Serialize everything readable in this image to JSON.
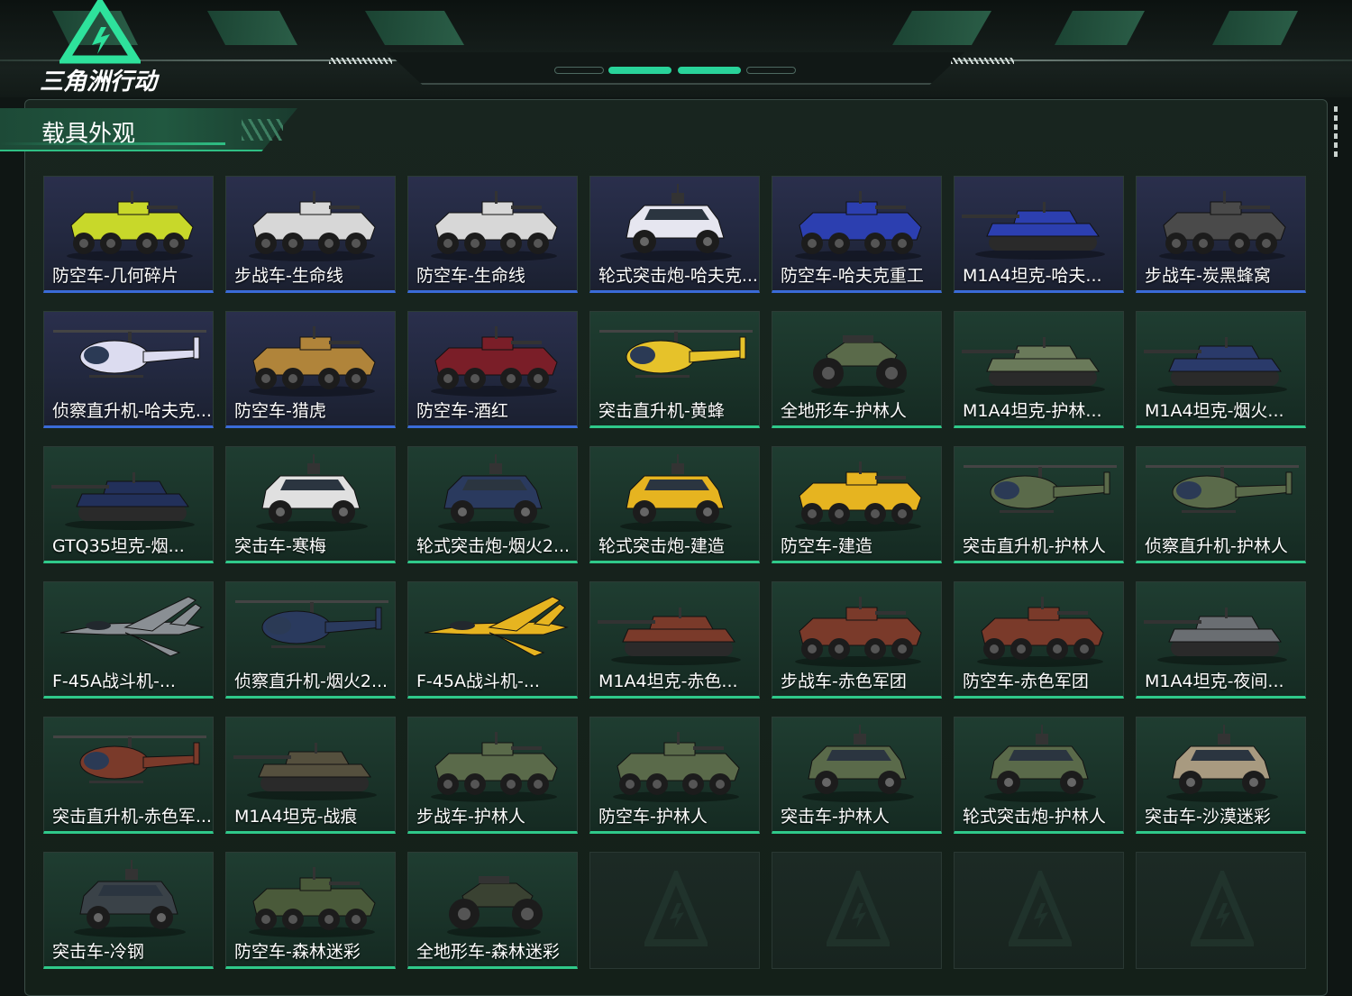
{
  "game": {
    "title": "三角洲行动"
  },
  "header": {
    "pills": [
      false,
      true,
      true,
      false
    ]
  },
  "panel": {
    "title": "载具外观"
  },
  "colors": {
    "accent_green": "#2fc98a",
    "rarity_blue": "#3a6bd8",
    "panel_bg": "#18251f"
  },
  "items": [
    {
      "name": "防空车-几何碎片",
      "type": "wheeled",
      "rarity": "blue",
      "color": "#c8d82a"
    },
    {
      "name": "步战车-生命线",
      "type": "wheeled",
      "rarity": "blue",
      "color": "#d7d7d7"
    },
    {
      "name": "防空车-生命线",
      "type": "wheeled",
      "rarity": "blue",
      "color": "#d7d7d7"
    },
    {
      "name": "轮式突击炮-哈夫克...",
      "type": "car",
      "rarity": "blue",
      "color": "#e6e6f0"
    },
    {
      "name": "防空车-哈夫克重工",
      "type": "wheeled",
      "rarity": "blue",
      "color": "#2c3fb0"
    },
    {
      "name": "M1A4坦克-哈夫...",
      "type": "tank",
      "rarity": "blue",
      "color": "#2c3fb0"
    },
    {
      "name": "步战车-炭黑蜂窝",
      "type": "wheeled",
      "rarity": "blue",
      "color": "#4a4a4a"
    },
    {
      "name": "侦察直升机-哈夫克...",
      "type": "heli",
      "rarity": "blue",
      "color": "#dcdcf0"
    },
    {
      "name": "防空车-猎虎",
      "type": "wheeled",
      "rarity": "blue",
      "color": "#b0843a"
    },
    {
      "name": "防空车-酒红",
      "type": "wheeled",
      "rarity": "blue",
      "color": "#7a1e28"
    },
    {
      "name": "突击直升机-黄蜂",
      "type": "heli",
      "rarity": "green",
      "color": "#e6c22a"
    },
    {
      "name": "全地形车-护林人",
      "type": "atv",
      "rarity": "green",
      "color": "#5a6a4a"
    },
    {
      "name": "M1A4坦克-护林...",
      "type": "tank",
      "rarity": "green",
      "color": "#6a7a5a"
    },
    {
      "name": "M1A4坦克-烟火...",
      "type": "tank",
      "rarity": "green",
      "color": "#2a3a6a"
    },
    {
      "name": "GTQ35坦克-烟...",
      "type": "tank",
      "rarity": "green",
      "color": "#22305a"
    },
    {
      "name": "突击车-寒梅",
      "type": "car",
      "rarity": "green",
      "color": "#e0e0e0"
    },
    {
      "name": "轮式突击炮-烟火2...",
      "type": "car",
      "rarity": "green",
      "color": "#2a3a5e"
    },
    {
      "name": "轮式突击炮-建造",
      "type": "car",
      "rarity": "green",
      "color": "#e6b420"
    },
    {
      "name": "防空车-建造",
      "type": "wheeled",
      "rarity": "green",
      "color": "#e6b420"
    },
    {
      "name": "突击直升机-护林人",
      "type": "heli",
      "rarity": "green",
      "color": "#5a6a4a"
    },
    {
      "name": "侦察直升机-护林人",
      "type": "heli",
      "rarity": "green",
      "color": "#5a6a4a"
    },
    {
      "name": "F-45A战斗机-...",
      "type": "jet",
      "rarity": "green",
      "color": "#8a8f94"
    },
    {
      "name": "侦察直升机-烟火2...",
      "type": "heli",
      "rarity": "green",
      "color": "#2a3a5e"
    },
    {
      "name": "F-45A战斗机-...",
      "type": "jet",
      "rarity": "green",
      "color": "#e6b420"
    },
    {
      "name": "M1A4坦克-赤色...",
      "type": "tank",
      "rarity": "green",
      "color": "#7a3a2a"
    },
    {
      "name": "步战车-赤色军团",
      "type": "wheeled",
      "rarity": "green",
      "color": "#7a3a2a"
    },
    {
      "name": "防空车-赤色军团",
      "type": "wheeled",
      "rarity": "green",
      "color": "#7a3a2a"
    },
    {
      "name": "M1A4坦克-夜间...",
      "type": "tank",
      "rarity": "green",
      "color": "#6a6e72"
    },
    {
      "name": "突击直升机-赤色军...",
      "type": "heli",
      "rarity": "green",
      "color": "#7a3a2a"
    },
    {
      "name": "M1A4坦克-战痕",
      "type": "tank",
      "rarity": "green",
      "color": "#55503e"
    },
    {
      "name": "步战车-护林人",
      "type": "wheeled",
      "rarity": "green",
      "color": "#5a6a4a"
    },
    {
      "name": "防空车-护林人",
      "type": "wheeled",
      "rarity": "green",
      "color": "#5a6a4a"
    },
    {
      "name": "突击车-护林人",
      "type": "car",
      "rarity": "green",
      "color": "#5a6a4a"
    },
    {
      "name": "轮式突击炮-护林人",
      "type": "car",
      "rarity": "green",
      "color": "#5a6a4a"
    },
    {
      "name": "突击车-沙漠迷彩",
      "type": "car",
      "rarity": "green",
      "color": "#a89a80"
    },
    {
      "name": "突击车-冷钢",
      "type": "car",
      "rarity": "green",
      "color": "#3a4248"
    },
    {
      "name": "防空车-森林迷彩",
      "type": "wheeled",
      "rarity": "green",
      "color": "#4a5a3a"
    },
    {
      "name": "全地形车-森林迷彩",
      "type": "atv",
      "rarity": "green",
      "color": "#3a4232"
    },
    {
      "name": "",
      "type": "empty",
      "rarity": "empty",
      "color": ""
    },
    {
      "name": "",
      "type": "empty",
      "rarity": "empty",
      "color": ""
    },
    {
      "name": "",
      "type": "empty",
      "rarity": "empty",
      "color": ""
    },
    {
      "name": "",
      "type": "empty",
      "rarity": "empty",
      "color": ""
    }
  ]
}
